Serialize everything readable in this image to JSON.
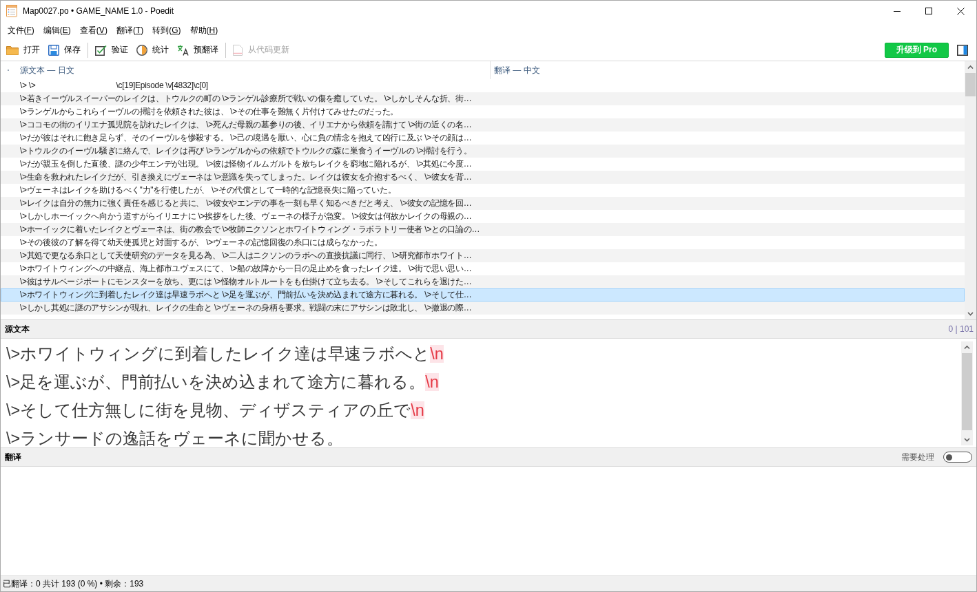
{
  "window": {
    "title": "Map0027.po • GAME_NAME 1.0 - Poedit"
  },
  "menu": [
    "文件(F)",
    "编辑(E)",
    "查看(V)",
    "翻译(T)",
    "转到(G)",
    "帮助(H)"
  ],
  "toolbar": {
    "groups": [
      [
        {
          "label": "打开",
          "disabled": false
        },
        {
          "label": "保存",
          "disabled": false
        }
      ],
      [
        {
          "label": "验证",
          "disabled": false
        },
        {
          "label": "统计",
          "disabled": false
        },
        {
          "label": "预翻译",
          "disabled": false
        }
      ],
      [
        {
          "label": "从代码更新",
          "disabled": true
        }
      ]
    ],
    "upgrade_button": "升级到 Pro"
  },
  "list": {
    "columns": [
      "源文本 — 日文",
      "翻译 — 中文"
    ],
    "rows": [
      {
        "source": "\\> \\>　　　　　　　　　　\\c[19]Episode \\v[4832]\\c[0]",
        "selected": false
      },
      {
        "source": "\\>若きイーヴルスイーパーのレイクは、トウルクの町の \\>ランゲル診療所で戦いの傷を癒していた。 \\>しかしそんな折、街…",
        "selected": false
      },
      {
        "source": "\\>ランゲルからこれらイーヴルの掃討を依頼された彼は、 \\>その仕事を難無く片付けてみせたのだった。",
        "selected": false
      },
      {
        "source": "\\>ココモの街のイリエナ孤児院を訪れたレイクは、 \\>死んだ母親の墓参りの後、イリエナから依頼を請けて \\>街の近くの名…",
        "selected": false
      },
      {
        "source": "\\>だが彼はそれに飽き足らず、そのイーヴルを惨殺する。 \\>己の境遇を厭い、心に負の情念を抱えて凶行に及ぶ \\>その顔は…",
        "selected": false
      },
      {
        "source": "\\>トウルクのイーヴル騒ぎに絡んで、レイクは再び \\>ランゲルからの依頼でトウルクの森に巣食うイーヴルの \\>掃討を行う。",
        "selected": false
      },
      {
        "source": "\\>だが親玉を倒した直後、謎の少年エンデが出現。 \\>彼は怪物イルムガルトを放ちレイクを窮地に陥れるが、 \\>其処に今度…",
        "selected": false
      },
      {
        "source": "\\>生命を救われたレイクだが、引き換えにヴェーネは \\>意識を失ってしまった。レイクは彼女を介抱するべく、 \\>彼女を背…",
        "selected": false
      },
      {
        "source": "\\>ヴェーネはレイクを助けるべく\"力\"を行使したが、 \\>その代償として一時的な記憶喪失に陥っていた。",
        "selected": false
      },
      {
        "source": "\\>レイクは自分の無力に強く責任を感じると共に、 \\>彼女やエンデの事を一刻も早く知るべきだと考え、 \\>彼女の記憶を回…",
        "selected": false
      },
      {
        "source": "\\>しかしホーイックへ向かう道すがらイリエナに \\>挨拶をした後、ヴェーネの様子が急変。 \\>彼女は何故かレイクの母親の…",
        "selected": false
      },
      {
        "source": "\\>ホーイックに着いたレイクとヴェーネは、街の教会で \\>牧師ニクソンとホワイトウィング・ラボラトリー使者 \\>との口論の…",
        "selected": false
      },
      {
        "source": "\\>その後彼の了解を得て幼天使孤児と対面するが、 \\>ヴェーネの記憶回復の糸口には成らなかった。",
        "selected": false
      },
      {
        "source": "\\>其処で更なる糸口として天使研究のデータを見る為、 \\>二人はニクソンのラボへの直接抗議に同行、 \\>研究都市ホワイト…",
        "selected": false
      },
      {
        "source": "\\>ホワイトウィングへの中継点、海上都市ユヴェスにて、 \\>船の故障から一日の足止めを食ったレイク達。 \\>街で思い思い…",
        "selected": false
      },
      {
        "source": "\\>彼はサルベージポートにモンスターを放ち、更には \\>怪物オルトルートをも仕掛けて立ち去る。 \\>そしてこれらを退けた…",
        "selected": false
      },
      {
        "source": "\\>ホワイトウィングに到着したレイク達は早速ラボへと \\>足を運ぶが、門前払いを決め込まれて途方に暮れる。 \\>そして仕…",
        "selected": true
      },
      {
        "source": "\\>しかし其処に謎のアサシンが現れ、レイクの生命と \\>ヴェーネの身柄を要求。戦闘の末にアサシンは敗北し、 \\>撤退の際…",
        "selected": false
      }
    ]
  },
  "source_panel": {
    "title": "源文本",
    "counter": "0 | 101",
    "lines": [
      {
        "text": "\\>ホワイトウィングに到着したレイク達は早速ラボへと",
        "newline_mark": "\\n"
      },
      {
        "text": "\\>足を運ぶが、門前払いを決め込まれて途方に暮れる。",
        "newline_mark": "\\n"
      },
      {
        "text": "\\>そして仕方無しに街を見物、ディザスティアの丘で",
        "newline_mark": "\\n"
      },
      {
        "text": "\\>ランサードの逸話をヴェーネに聞かせる。"
      }
    ]
  },
  "translation_panel": {
    "title": "翻译",
    "needs_work": {
      "label": "需要处理",
      "on": false
    }
  },
  "status_bar": "已翻译：0 共计 193 (0 %) • 剩余：193"
}
